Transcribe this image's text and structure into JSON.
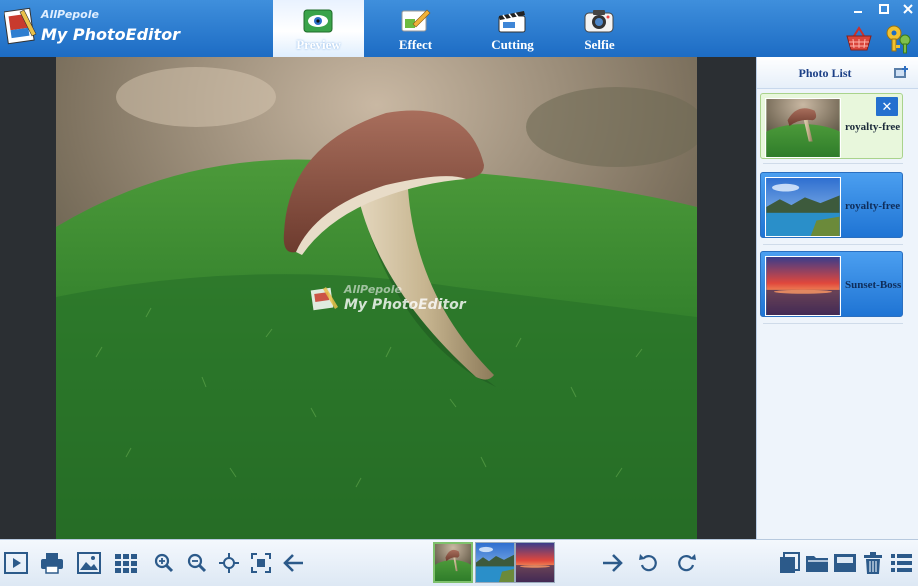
{
  "app": {
    "brand_small": "AllPepole",
    "brand_big": "My PhotoEditor"
  },
  "tabs": [
    {
      "label": "Preview",
      "icon": "eye-icon",
      "active": true
    },
    {
      "label": "Effect",
      "icon": "brush-icon",
      "active": false
    },
    {
      "label": "Cutting",
      "icon": "clapper-icon",
      "active": false
    },
    {
      "label": "Selfie",
      "icon": "camera-icon",
      "active": false
    }
  ],
  "window_controls": [
    "minimize-icon",
    "maximize-icon",
    "close-icon"
  ],
  "header_actions": [
    "basket-icon",
    "keys-icon"
  ],
  "canvas": {
    "watermark_small": "AllPepole",
    "watermark_big": "My PhotoEditor"
  },
  "photo_list": {
    "title": "Photo List",
    "items": [
      {
        "label": "royalty-free",
        "thumb": "mushroom",
        "selected": true
      },
      {
        "label": "royalty-free",
        "thumb": "lake",
        "selected": false
      },
      {
        "label": "Sunset-Boss",
        "thumb": "sunset",
        "selected": false
      }
    ]
  },
  "toolbar": {
    "left": [
      "play-icon",
      "print-icon",
      "picture-icon",
      "grid-icon",
      "zoom-in-icon",
      "zoom-out-icon",
      "fit-icon",
      "actual-size-icon",
      "arrow-left-icon"
    ],
    "filmstrip": [
      "mushroom",
      "lake",
      "sunset"
    ],
    "middle": [
      "arrow-right-icon",
      "rotate-left-icon",
      "rotate-right-icon"
    ],
    "right": [
      "copy-icon",
      "folder-icon",
      "save-icon",
      "trash-icon",
      "list-icon"
    ]
  },
  "colors": {
    "header": "#2a7ad4",
    "selected_item": "#e8f7dc",
    "blue_item": "#2a82e0",
    "canvas_bg": "#2b2f33"
  }
}
